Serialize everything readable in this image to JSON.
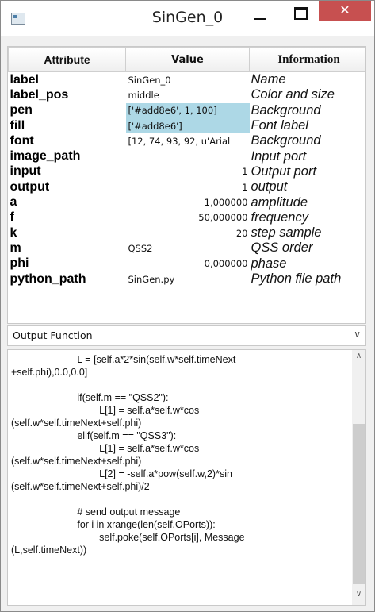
{
  "window": {
    "title": "SinGen_0",
    "close_glyph": "✕"
  },
  "table": {
    "headers": {
      "attribute": "Attribute",
      "value": "Value",
      "information": "Information"
    },
    "rows": [
      {
        "attribute": "label",
        "value": "SinGen_0",
        "information": "Name"
      },
      {
        "attribute": "label_pos",
        "value": "middle",
        "information": "Color and size"
      },
      {
        "attribute": "pen",
        "value": "['#add8e6', 1, 100]",
        "information": "Background"
      },
      {
        "attribute": "fill",
        "value": "['#add8e6']",
        "information": "Font label"
      },
      {
        "attribute": "font",
        "value": "[12, 74, 93, 92, u'Arial",
        "information": "Background"
      },
      {
        "attribute": "image_path",
        "value": "",
        "information": "Input port"
      },
      {
        "attribute": "input",
        "value": "1",
        "information": "Output port"
      },
      {
        "attribute": "output",
        "value": "1",
        "information": "output"
      },
      {
        "attribute": "a",
        "value": "1,000000",
        "information": "amplitude"
      },
      {
        "attribute": "f",
        "value": "50,000000",
        "information": "frequency"
      },
      {
        "attribute": "k",
        "value": "20",
        "information": "step sample"
      },
      {
        "attribute": "m",
        "value": "QSS2",
        "information": "QSS order"
      },
      {
        "attribute": "phi",
        "value": "0,000000",
        "information": "phase"
      },
      {
        "attribute": "python_path",
        "value": "SinGen.py",
        "information": "Python file path"
      }
    ],
    "highlight_color": "#add8e6"
  },
  "output_function": {
    "label": "Output Function",
    "code": "                        L = [self.a*2*sin(self.w*self.timeNext\n+self.phi),0.0,0.0]\n\n                        if(self.m == \"QSS2\"):\n                                L[1] = self.a*self.w*cos\n(self.w*self.timeNext+self.phi)\n                        elif(self.m == \"QSS3\"):\n                                L[1] = self.a*self.w*cos\n(self.w*self.timeNext+self.phi)\n                                L[2] = -self.a*pow(self.w,2)*sin\n(self.w*self.timeNext+self.phi)/2\n\n                        # send output message\n                        for i in xrange(len(self.OPorts)):\n                                self.poke(self.OPorts[i], Message\n(L,self.timeNext))"
  }
}
